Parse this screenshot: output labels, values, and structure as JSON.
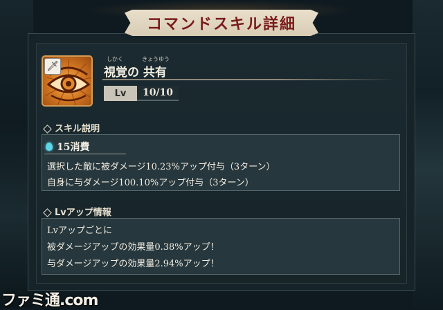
{
  "header": {
    "title": "コマンドスキル詳細"
  },
  "skill": {
    "icon": "eye-icon",
    "badge_icon": "sword-icon",
    "name": "視覚の 共有",
    "ruby_1": "しかく",
    "ruby_2": "きょうゆう",
    "lv_label": "Lv",
    "lv_value": "10/10"
  },
  "description": {
    "heading": "スキル説明",
    "cost_icon": "drop-icon",
    "cost": "15消費",
    "lines": [
      "選択した敵に被ダメージ10.23%アップ付与（3ターン）",
      "自身に与ダメージ100.10%アップ付与（3ターン）"
    ]
  },
  "lvup": {
    "heading": "Lvアップ情報",
    "lines": [
      "Lvアップごとに",
      "被ダメージアップの効果量0.38%アップ！",
      "与ダメージアップの効果量2.94%アップ！"
    ]
  },
  "watermark": "ファミ通.com",
  "colors": {
    "title": "#7a1c1c",
    "banner": "#e3d8c2",
    "panel": "#16242a",
    "box": "#26373d",
    "cost_drop": "#5fd6e6"
  }
}
